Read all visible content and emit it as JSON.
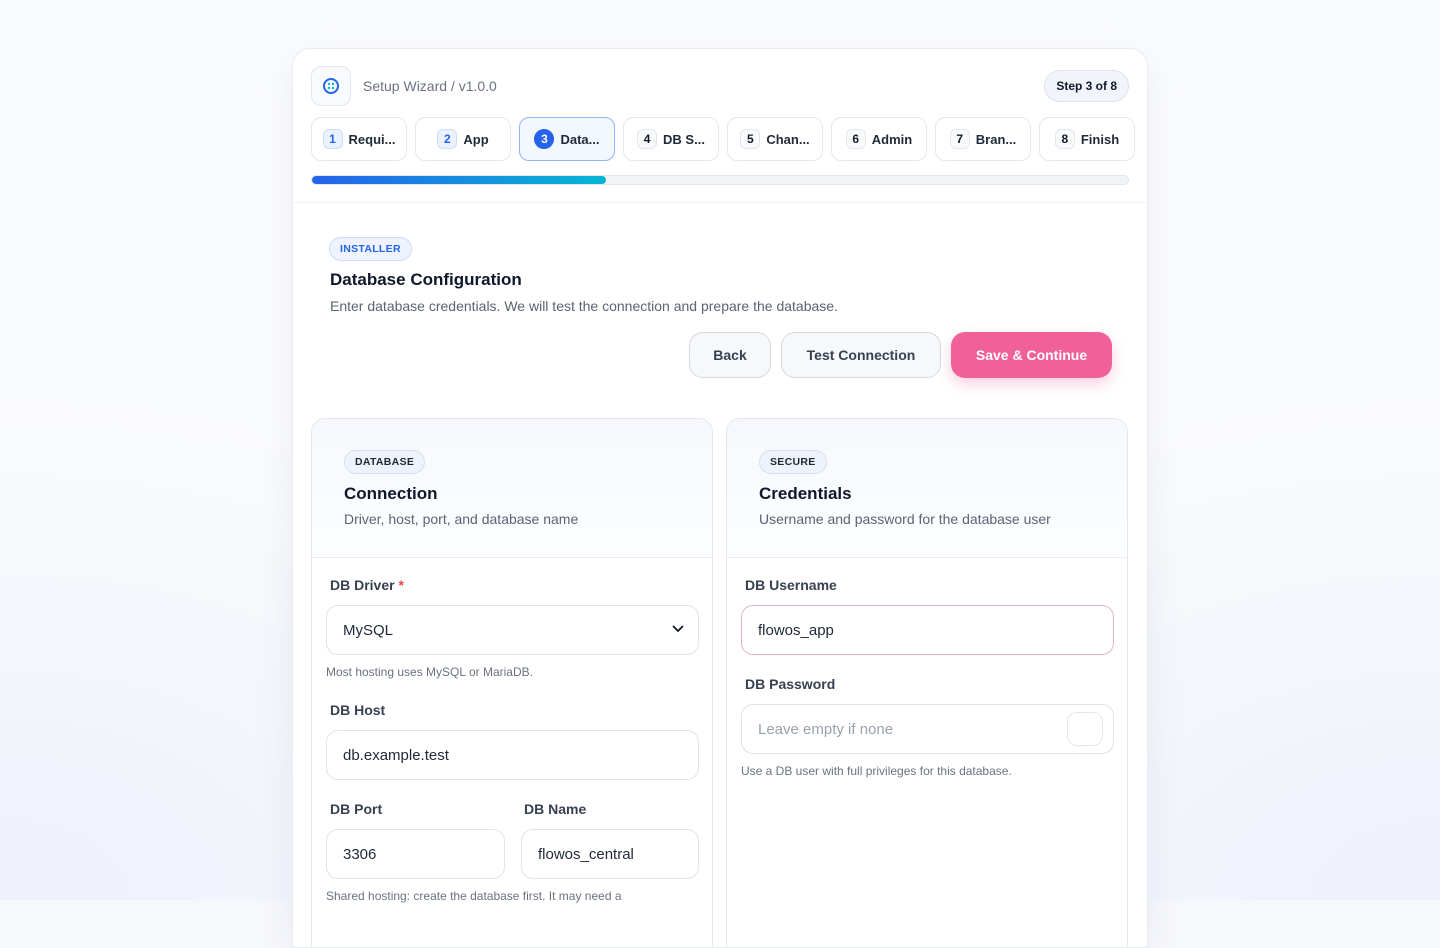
{
  "app": {
    "title": "Setup Wizard / v1.0.0",
    "step_indicator": "Step 3 of 8",
    "progress": 0.36
  },
  "steps": [
    {
      "num": "1",
      "label": "Requi..."
    },
    {
      "num": "2",
      "label": "App"
    },
    {
      "num": "3",
      "label": "Data..."
    },
    {
      "num": "4",
      "label": "DB S..."
    },
    {
      "num": "5",
      "label": "Chan..."
    },
    {
      "num": "6",
      "label": "Admin"
    },
    {
      "num": "7",
      "label": "Bran..."
    },
    {
      "num": "8",
      "label": "Finish"
    }
  ],
  "header": {
    "badge": "INSTALLER",
    "title": "Database Configuration",
    "description": "Enter database credentials. We will test the connection and prepare the database."
  },
  "actions": {
    "back": "Back",
    "test": "Test Connection",
    "save": "Save & Continue"
  },
  "connection": {
    "badge": "DATABASE",
    "title": "Connection",
    "subtitle": "Driver, host, port, and database name",
    "driver_label": "DB Driver",
    "driver_required": "*",
    "driver_value": "MySQL",
    "driver_hint": "Most hosting uses MySQL or MariaDB.",
    "host_label": "DB Host",
    "host_value": "db.example.test",
    "port_label": "DB Port",
    "port_value": "3306",
    "name_label": "DB Name",
    "name_value": "flowos_central",
    "name_hint": "Shared hosting: create the database first. It may need a"
  },
  "credentials": {
    "badge": "SECURE",
    "title": "Credentials",
    "subtitle": "Username and password for the database user",
    "username_label": "DB Username",
    "username_value": "flowos_app",
    "password_label": "DB Password",
    "password_placeholder": "Leave empty if none",
    "password_hint": "Use a DB user with full privileges for this database."
  },
  "colors": {
    "accent_blue": "#2563eb",
    "progress_end": "#06b6d4",
    "primary_pink": "#f0619a",
    "required_red": "#ef4444"
  },
  "icons": {
    "logo": "wizard-logo-icon",
    "select": "chevron-down-icon",
    "password_toggle": "eye-toggle-icon"
  }
}
